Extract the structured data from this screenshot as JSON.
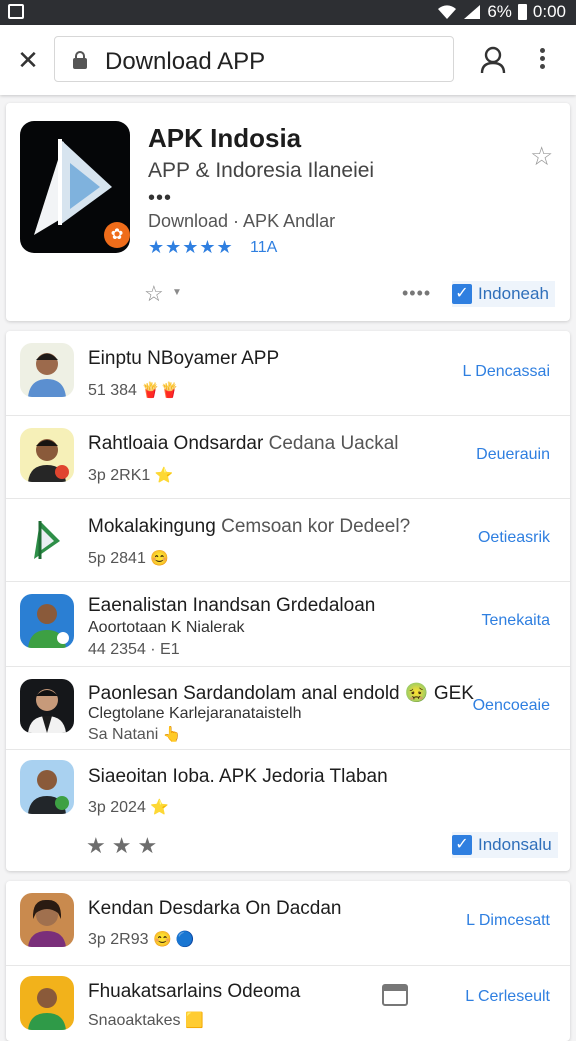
{
  "status_bar": {
    "battery": "6%",
    "time": "0:00"
  },
  "toolbar": {
    "url_text": "Download APP"
  },
  "hero": {
    "title": "APK Indosia",
    "subtitle": "APP & Indoresia Ilaneiei",
    "dots": "•••",
    "download_text": "Download · APK Andlar",
    "stars": "★★★★★",
    "rating_count": "11A",
    "more": "••••",
    "lang_button": "Indoneah"
  },
  "list": [
    {
      "title": "Einptu NBoyamer APP",
      "title_muted": "",
      "subtitle": "",
      "meta": "51 384",
      "meta_emoji": "🍟🍟",
      "action": "L Dencassai",
      "avatar": "person-1"
    },
    {
      "title": "Rahtloaia Ondsardar",
      "title_muted": "Cedana Uackal",
      "subtitle": "",
      "meta": "3p 2RK1",
      "meta_emoji": "⭐",
      "action": "Deuerauin",
      "avatar": "person-2"
    },
    {
      "title": "Mokalakingung",
      "title_muted": "Cemsoan kor Dedeel?",
      "subtitle": "",
      "meta": "5p 2841",
      "meta_emoji": "😊",
      "action": "Oetieasrik",
      "avatar": "app-logo"
    },
    {
      "title": "Eaenalistan Inandsan Grdedaloan",
      "title_muted": "",
      "subtitle": "Aoortotaan K Nialerak",
      "meta": "44 2354 · E1",
      "meta_emoji": "",
      "action": "Tenekaita",
      "avatar": "person-3"
    },
    {
      "title": "Paonlesan Sardandolam anal endold 🤢 GEK",
      "title_muted": "",
      "subtitle": "Clegtolane Karlejaranataistelh",
      "meta": "Sa Natani",
      "meta_emoji": "👆",
      "action": "Oencoeaie",
      "avatar": "person-4"
    },
    {
      "title": "Siaeoitan Ioba. APK Jedoria Tlaban",
      "title_muted": "",
      "subtitle": "",
      "meta": "3p 2024",
      "meta_emoji": "⭐",
      "action": "",
      "avatar": "person-5"
    }
  ],
  "list_footer": {
    "stars": "★★★",
    "lang_button": "Indonsalu"
  },
  "list2": [
    {
      "title": "Kendan Desdarka On Dacdan",
      "meta": "3p 2R93",
      "meta_emoji": "😊 🔵",
      "action": "L Dimcesatt",
      "avatar": "person-6"
    },
    {
      "title": "Fhuakatsarlains Odeoma",
      "meta": "Snaoaktakes",
      "meta_emoji": "🟨",
      "action": "L Cerleseult",
      "avatar": "person-7"
    }
  ],
  "colors": {
    "accent": "#2f7fe0",
    "status_bar": "#2d2f33"
  }
}
